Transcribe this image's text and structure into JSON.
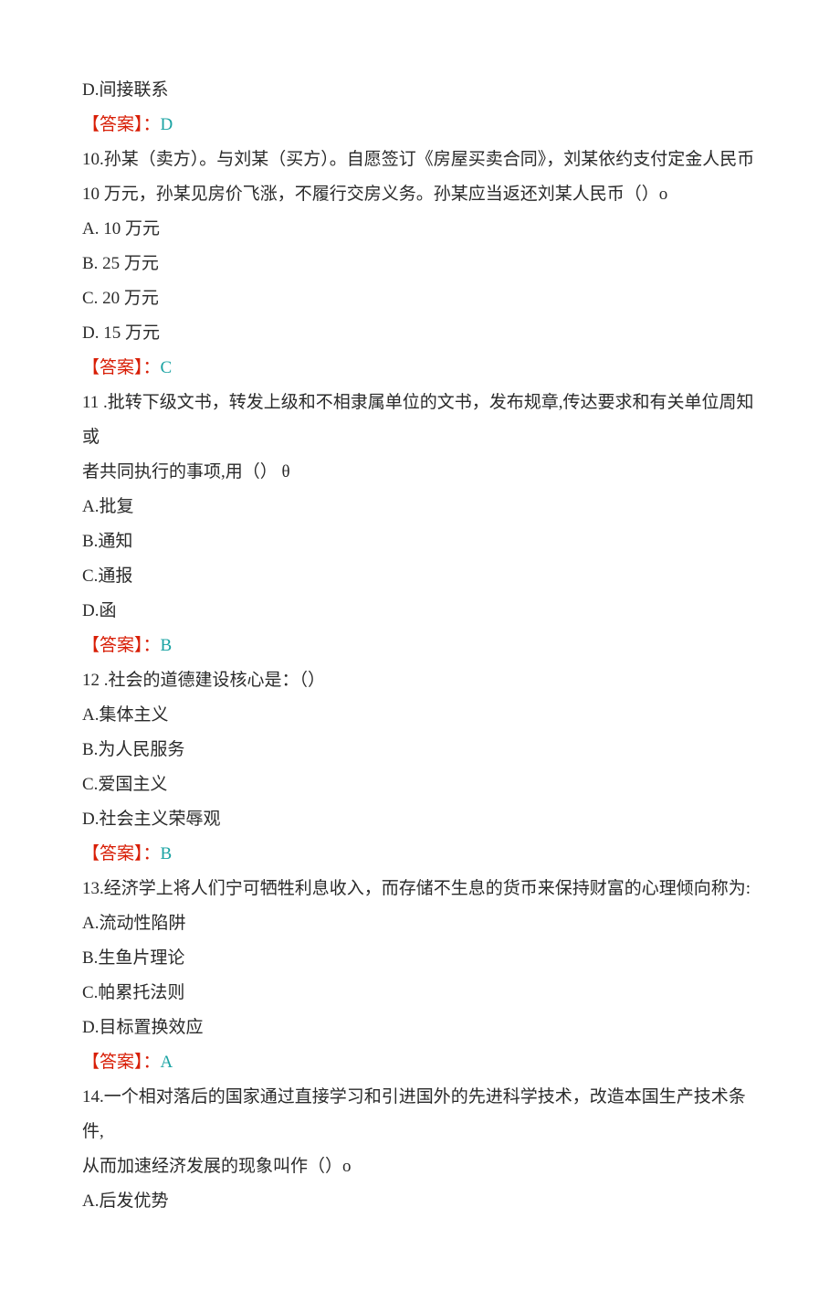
{
  "q9": {
    "optD": "D.间接联系",
    "ansLabel": "【答案】：",
    "ansVal": "D"
  },
  "q10": {
    "stem1": "10.孙某（卖方）。与刘某（买方）。自愿签订《房屋买卖合同》，刘某依约支付定金人民币",
    "stem2": "10 万元，孙某见房价飞涨，不履行交房义务。孙某应当返还刘某人民币（）o",
    "optA": "A.  10 万元",
    "optB": "B.  25 万元",
    "optC": "C.  20 万元",
    "optD": "D.  15 万元",
    "ansLabel": "【答案】：",
    "ansVal": "C"
  },
  "q11": {
    "stem1": "11 .批转下级文书，转发上级和不相隶属单位的文书，发布规章,传达要求和有关单位周知或",
    "stem2": "者共同执行的事项,用（） θ",
    "optA": "A.批复",
    "optB": "B.通知",
    "optC": "C.通报",
    "optD": "D.函",
    "ansLabel": "【答案】：",
    "ansVal": "B"
  },
  "q12": {
    "stem": "12 .社会的道德建设核心是：（）",
    "optA": "A.集体主义",
    "optB": "B.为人民服务",
    "optC": "C.爱国主义",
    "optD": "D.社会主义荣辱观",
    "ansLabel": "【答案】：",
    "ansVal": "B"
  },
  "q13": {
    "stem": "13.经济学上将人们宁可牺牲利息收入，而存储不生息的货币来保持财富的心理倾向称为:",
    "optA": "A.流动性陷阱",
    "optB": "B.生鱼片理论",
    "optC": "C.帕累托法则",
    "optD": "D.目标置换效应",
    "ansLabel": "【答案】：",
    "ansVal": "A"
  },
  "q14": {
    "stem1": "14.一个相对落后的国家通过直接学习和引进国外的先进科学技术，改造本国生产技术条件,",
    "stem2": "从而加速经济发展的现象叫作（）o",
    "optA": "A.后发优势"
  }
}
